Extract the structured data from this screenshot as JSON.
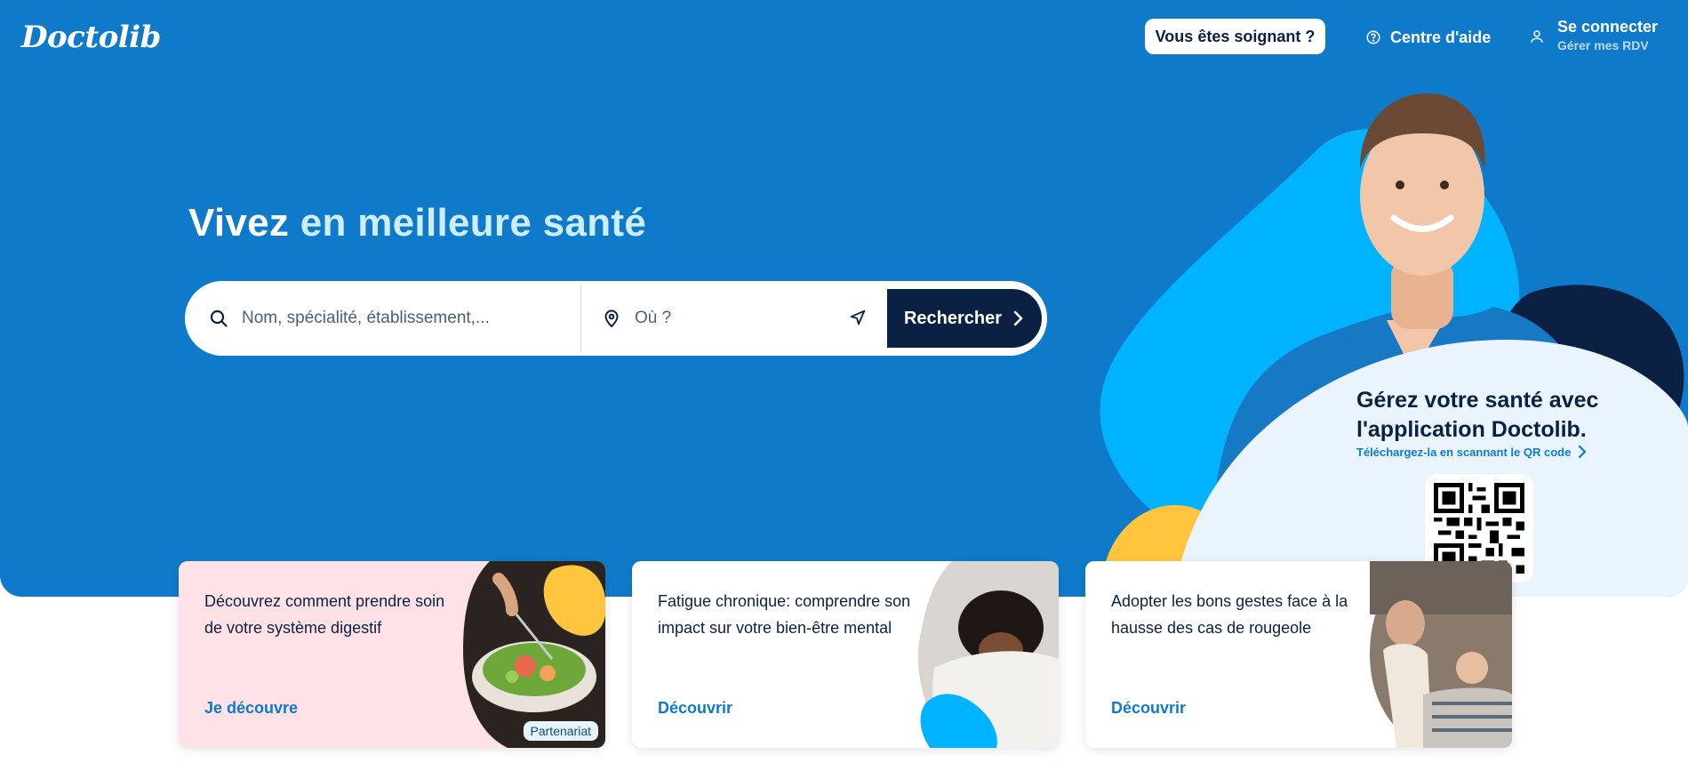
{
  "header": {
    "logo": "Doctolib",
    "pro_button": "Vous êtes soignant ?",
    "help_link": "Centre d'aide",
    "login_title": "Se connecter",
    "login_subtitle": "Gérer mes RDV"
  },
  "hero": {
    "headline_part1": "Vivez",
    "headline_part2": "en meilleure santé"
  },
  "search": {
    "what_placeholder": "Nom, spécialité, établissement,...",
    "where_placeholder": "Où ?",
    "button_label": "Rechercher"
  },
  "promo": {
    "title": "Gérez votre santé avec l'application Doctolib.",
    "subtitle": "Téléchargez-la en scannant le QR code"
  },
  "cards": [
    {
      "text": "Découvrez comment prendre soin de votre système digestif",
      "link": "Je découvre",
      "badge": "Partenariat"
    },
    {
      "text": "Fatigue chronique: comprendre son impact sur votre bien-être mental",
      "link": "Découvrir"
    },
    {
      "text": "Adopter les bons gestes face à la hausse des cas de rougeole",
      "link": "Découvrir"
    }
  ],
  "icons": {
    "help": "help-circle-icon",
    "user": "user-icon",
    "search": "search-icon",
    "location": "location-pin-icon",
    "geolocate": "navigation-arrow-icon",
    "chevron": "chevron-right-icon"
  },
  "colors": {
    "hero_bg": "#107ACA",
    "navy": "#0B2144",
    "light_blue_blob": "#00B3FF",
    "yellow": "#FFC53D",
    "pink_card": "#FFE2E5",
    "link_blue": "#107ACA"
  }
}
